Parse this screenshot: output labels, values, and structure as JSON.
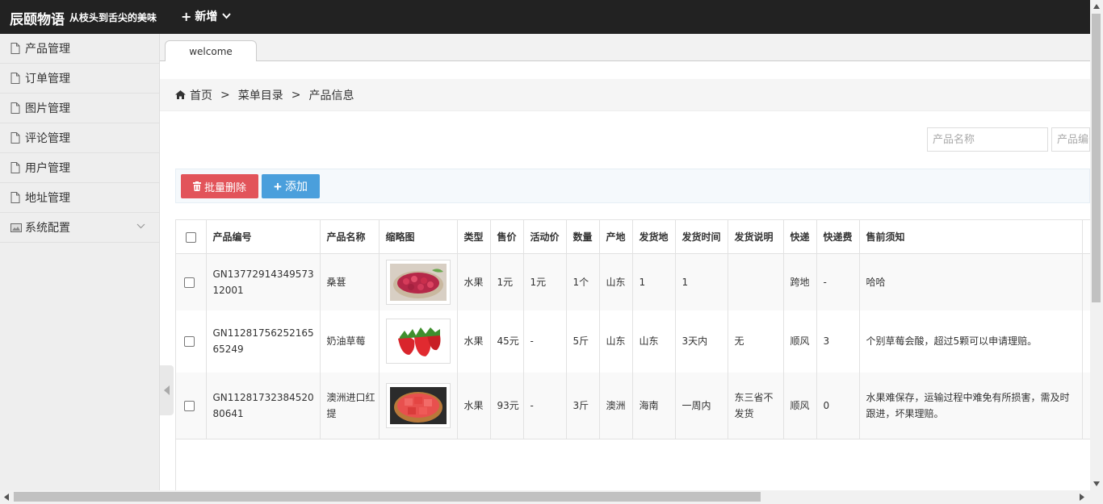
{
  "header": {
    "brand": "辰颐物语",
    "slogan": "从枝头到舌尖的美味",
    "new_label": "新增"
  },
  "sidebar": {
    "items": [
      {
        "label": "产品管理"
      },
      {
        "label": "订单管理"
      },
      {
        "label": "图片管理"
      },
      {
        "label": "评论管理"
      },
      {
        "label": "用户管理"
      },
      {
        "label": "地址管理"
      },
      {
        "label": "系统配置"
      }
    ]
  },
  "tabs": [
    {
      "label": "welcome"
    }
  ],
  "breadcrumb": {
    "home": "首页",
    "separator": ">",
    "level1": "菜单目录",
    "level2": "产品信息"
  },
  "search": {
    "name_placeholder": "产品名称",
    "code_placeholder": "产品编号"
  },
  "toolbar": {
    "batch_delete": "批量删除",
    "add": "添加"
  },
  "table": {
    "headers": [
      "产品编号",
      "产品名称",
      "缩略图",
      "类型",
      "售价",
      "活动价",
      "数量",
      "产地",
      "发货地",
      "发货时间",
      "发货说明",
      "快递",
      "快递费",
      "售前须知"
    ],
    "rows": [
      {
        "code": "GN1377291434957312001",
        "name": "桑葚",
        "thumb": "mulberry-image",
        "type": "水果",
        "price": "1元",
        "promo": "1元",
        "qty": "1个",
        "origin": "山东",
        "ship_from": "1",
        "ship_time": "1",
        "ship_note": "",
        "courier": "跨地",
        "fee": "-",
        "notice": "哈哈"
      },
      {
        "code": "GN1128175625216565249",
        "name": "奶油草莓",
        "thumb": "strawberry-image",
        "type": "水果",
        "price": "45元",
        "promo": "-",
        "qty": "5斤",
        "origin": "山东",
        "ship_from": "山东",
        "ship_time": "3天内",
        "ship_note": "无",
        "courier": "顺风",
        "fee": "3",
        "notice": "个别草莓会酸，超过5颗可以申请理赔。"
      },
      {
        "code": "GN1128173238452080641",
        "name": "澳洲进口红提",
        "thumb": "watermelon-image",
        "type": "水果",
        "price": "93元",
        "promo": "-",
        "qty": "3斤",
        "origin": "澳洲",
        "ship_from": "海南",
        "ship_time": "一周内",
        "ship_note": "东三省不发货",
        "courier": "顺风",
        "fee": "0",
        "notice": "水果难保存，运输过程中难免有所损害，需及时跟进，坏果理赔。"
      }
    ]
  },
  "colors": {
    "topbar": "#222222",
    "delete_button": "#e2545a",
    "add_button": "#4a9fdc"
  }
}
